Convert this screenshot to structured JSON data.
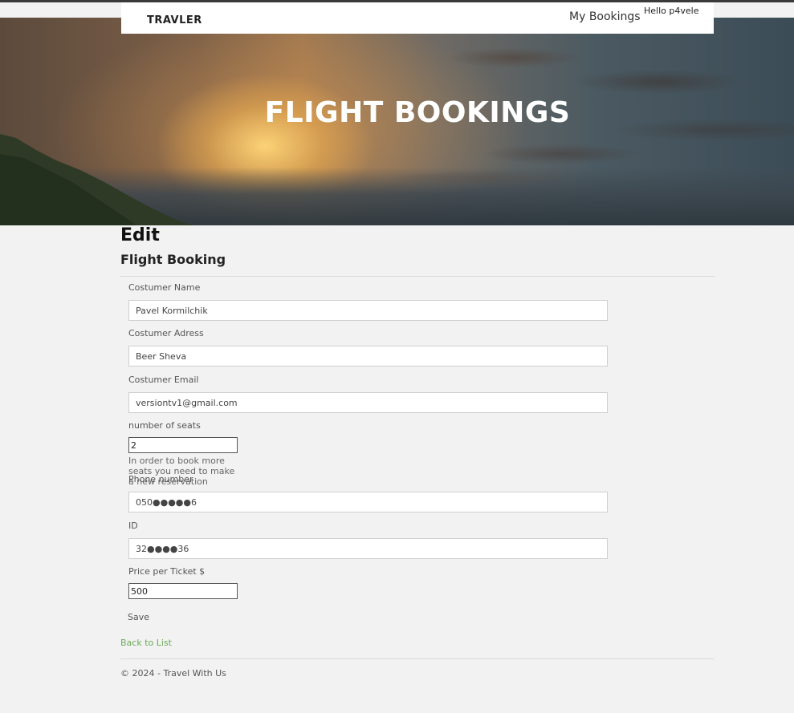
{
  "navbar": {
    "brand": "TRAVLER",
    "my_bookings": "My Bookings",
    "greeting": "Hello p4vele"
  },
  "hero": {
    "title": "FLIGHT BOOKINGS"
  },
  "page": {
    "heading": "Edit",
    "subheading": "Flight Booking"
  },
  "form": {
    "customer_name": {
      "label": "Costumer Name",
      "value": "Pavel Kormilchik"
    },
    "customer_address": {
      "label": "Costumer Adress",
      "value": "Beer Sheva"
    },
    "customer_email": {
      "label": "Costumer Email",
      "value": "versiontv1@gmail.com"
    },
    "seats": {
      "label": "number of seats",
      "value": "2",
      "help": "In order to book more seats you need to make a new reservation"
    },
    "phone": {
      "label": "Phone number",
      "value": "050●●●●●6"
    },
    "id": {
      "label": "ID",
      "value": "32●●●●36"
    },
    "price": {
      "label": "Price per Ticket $",
      "value": "500"
    },
    "save_label": "Save"
  },
  "back_link": "Back to List",
  "footer": "© 2024 - Travel With Us"
}
